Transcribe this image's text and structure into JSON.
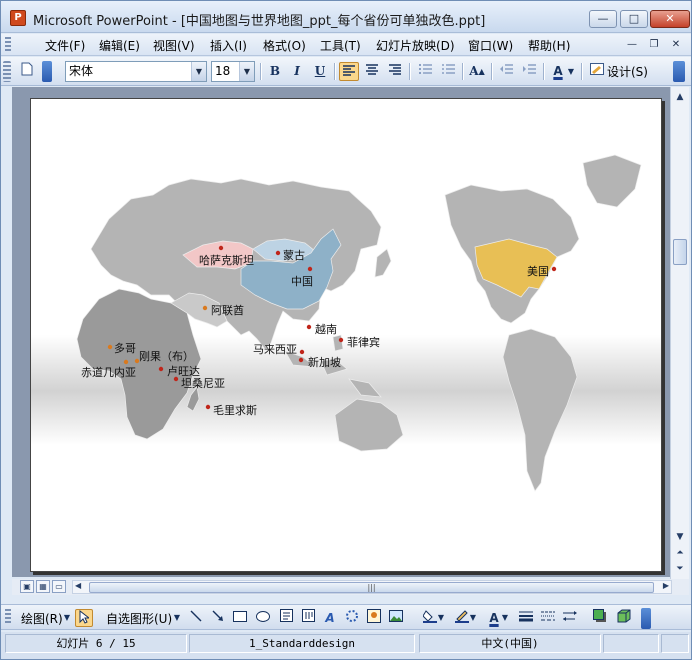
{
  "window": {
    "title": "Microsoft PowerPoint - [中国地图与世界地图_ppt_每个省份可单独改色.ppt]",
    "app_icon_glyph": "P",
    "minimize": "—",
    "maximize": "□",
    "close": "✕"
  },
  "menu": {
    "items": [
      "文件(F)",
      "编辑(E)",
      "视图(V)",
      "插入(I)",
      "格式(O)",
      "工具(T)",
      "幻灯片放映(D)",
      "窗口(W)",
      "帮助(H)"
    ],
    "mdi_minimize": "—",
    "mdi_restore": "❐",
    "mdi_close": "✕"
  },
  "format_toolbar": {
    "font_name": "宋体",
    "font_size": "18",
    "bold": "B",
    "italic": "I",
    "underline": "U",
    "design_label": "设计(S)"
  },
  "slide_map": {
    "labels": [
      {
        "text": "哈萨克斯坦"
      },
      {
        "text": "蒙古"
      },
      {
        "text": "中国"
      },
      {
        "text": "美国"
      },
      {
        "text": "阿联酋"
      },
      {
        "text": "越南"
      },
      {
        "text": "菲律宾"
      },
      {
        "text": "马来西亚"
      },
      {
        "text": "新加坡"
      },
      {
        "text": "多哥"
      },
      {
        "text": "刚果（布）"
      },
      {
        "text": "赤道几内亚"
      },
      {
        "text": "卢旺达"
      },
      {
        "text": "坦桑尼亚"
      },
      {
        "text": "毛里求斯"
      }
    ],
    "colors": {
      "land": "#b4b4b4",
      "africa": "#9a9a9a",
      "china": "#8eb1c8",
      "mongolia": "#bdd3e4",
      "kazakhstan": "#f2c7c7",
      "usa": "#e8bf55",
      "marker": "#c0261b",
      "marker_orange": "#d97a1f"
    }
  },
  "drawing_toolbar": {
    "draw_label": "绘图(R)",
    "autoshapes_label": "自选图形(U)"
  },
  "status": {
    "slide": "幻灯片 6 / 15",
    "design": "1_Standarddesign",
    "language": "中文(中国)"
  }
}
